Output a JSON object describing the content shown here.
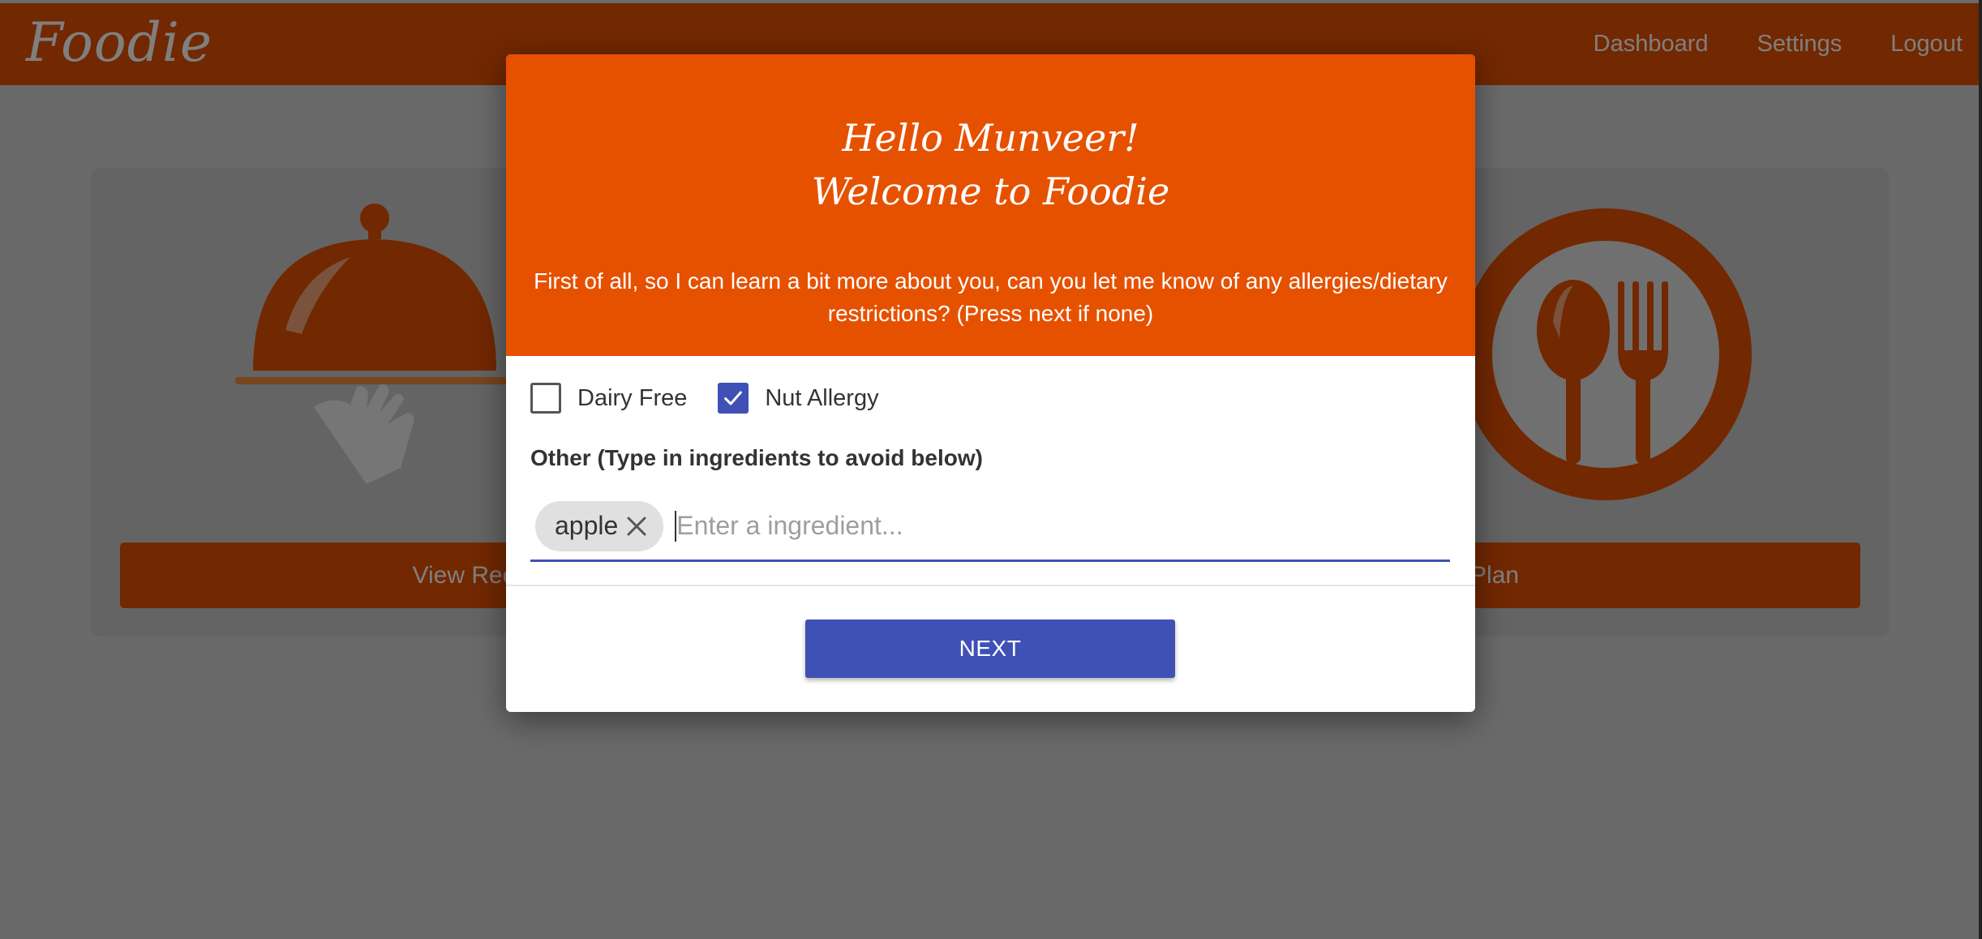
{
  "navbar": {
    "brand": "Foodie",
    "links": [
      "Dashboard",
      "Settings",
      "Logout"
    ]
  },
  "cards": {
    "left_button": "View Recommendations",
    "right_button": "View Meal Plan"
  },
  "modal": {
    "greeting_line1": "Hello Munveer!",
    "greeting_line2": "Welcome to Foodie",
    "intro": "First of all, so I can learn a bit more about you, can you let me know of any allergies/dietary restrictions? (Press next if none)",
    "options": [
      {
        "label": "Dairy Free",
        "checked": false
      },
      {
        "label": "Nut Allergy",
        "checked": true
      }
    ],
    "other_label": "Other (Type in ingredients to avoid below)",
    "chips": [
      "apple"
    ],
    "input_placeholder": "Enter a ingredient...",
    "input_value": "",
    "next_label": "NEXT"
  },
  "colors": {
    "brand_orange": "#e65100",
    "accent_indigo": "#3f51b5"
  },
  "icons": [
    "cloche-icon",
    "spoon-fork-plate-icon",
    "check-icon",
    "close-icon"
  ]
}
